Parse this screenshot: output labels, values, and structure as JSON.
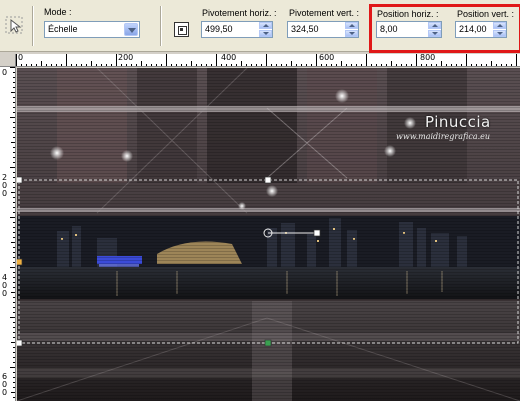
{
  "toolbar": {
    "mode_label": "Mode :",
    "mode_value": "Échelle",
    "pivot_h_label": "Pivotement horiz. :",
    "pivot_h_value": "499,50",
    "pivot_v_label": "Pivotement vert. :",
    "pivot_v_value": "324,50",
    "pos_h_label": "Position horiz. :",
    "pos_h_value": "8,00",
    "pos_v_label": "Position vert. :",
    "pos_v_value": "214,00"
  },
  "ruler": {
    "top": [
      "0",
      "200",
      "400",
      "600",
      "800"
    ],
    "left": [
      "0",
      "2",
      "0",
      "0",
      "4",
      "0",
      "0",
      "6",
      "0",
      "0",
      "8",
      "0"
    ]
  },
  "canvas": {
    "brand": "Pinuccia",
    "url": "www.maidiregrafica.eu"
  },
  "colors": {
    "toolbar_bg": "#ece9d8",
    "highlight": "#e01818",
    "input_border": "#7f9db9"
  }
}
